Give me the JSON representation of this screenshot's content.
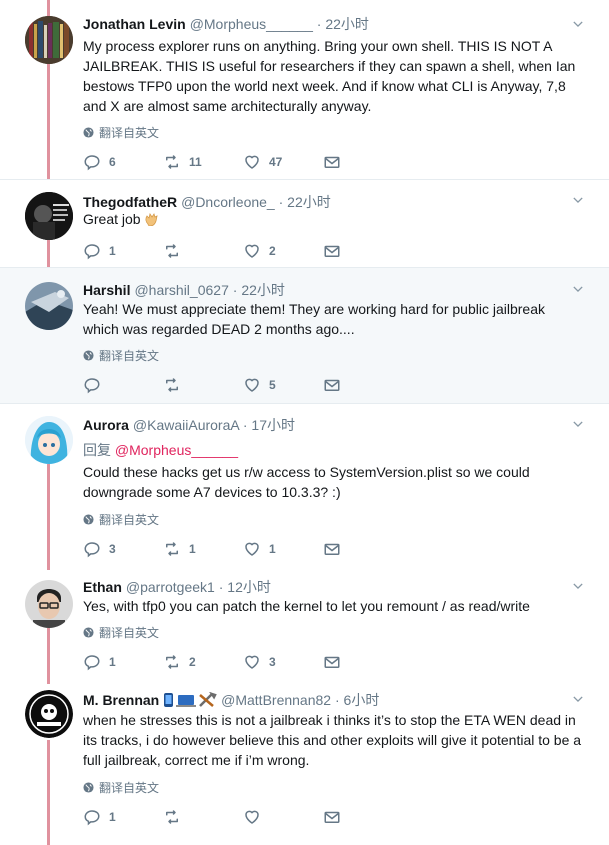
{
  "tweets": [
    {
      "name": "Jonathan Levin",
      "handle": "@Morpheus______",
      "sep": "·",
      "time": "22小时",
      "text": "My process explorer runs on anything. Bring your own shell. THIS IS NOT A JAILBREAK. THIS IS useful for researchers if they can spawn a shell, when Ian bestows TFP0 upon the world next week. And if know what CLI is  Anyway, 7,8 and X are almost same architecturally anyway.",
      "translate": "翻译自英文",
      "replies": "6",
      "retweets": "11",
      "likes": "47"
    },
    {
      "name": "ThegodfatheR",
      "handle": "@Dncorleone_",
      "sep": "·",
      "time": "22小时",
      "text": "Great job",
      "replies": "1",
      "retweets": "",
      "likes": "2"
    },
    {
      "name": "Harshil",
      "handle": "@harshil_0627",
      "sep": "·",
      "time": "22小时",
      "text": "Yeah! We must appreciate them! They are working hard for public jailbreak which was regarded DEAD 2 months ago....",
      "translate": "翻译自英文",
      "replies": "",
      "retweets": "",
      "likes": "5"
    },
    {
      "name": "Aurora",
      "handle": "@KawaiiAuroraA",
      "sep": "·",
      "time": "17小时",
      "reply_prefix": "回复",
      "reply_mention": "@Morpheus______",
      "text": "Could these hacks get us r/w access to SystemVersion.plist so we could downgrade some A7 devices to 10.3.3? :)",
      "translate": "翻译自英文",
      "replies": "3",
      "retweets": "1",
      "likes": "1"
    },
    {
      "name": "Ethan",
      "handle": "@parrotgeek1",
      "sep": "·",
      "time": "12小时",
      "text": "Yes, with tfp0 you can patch the kernel to let you remount / as read/write",
      "translate": "翻译自英文",
      "replies": "1",
      "retweets": "2",
      "likes": "3"
    },
    {
      "name": "M. Brennan",
      "handle": "@MattBrennan82",
      "sep": "·",
      "time": "6小时",
      "text": "when he stresses this is not a jailbreak i thinks it’s to stop the ETA WEN dead in its tracks, i do however believe this and other exploits will give it potential to be a full jailbreak, correct me if i’m wrong.",
      "translate": "翻译自英文",
      "replies": "1",
      "retweets": "",
      "likes": ""
    }
  ],
  "colors": {
    "thread_line": "#e0929e",
    "mention": "#e0245e",
    "muted": "#657786",
    "highlight_bg": "#f5f8fa"
  },
  "icons": [
    "reply-icon",
    "retweet-icon",
    "like-icon",
    "message-icon",
    "caret-down-icon",
    "globe-icon"
  ]
}
